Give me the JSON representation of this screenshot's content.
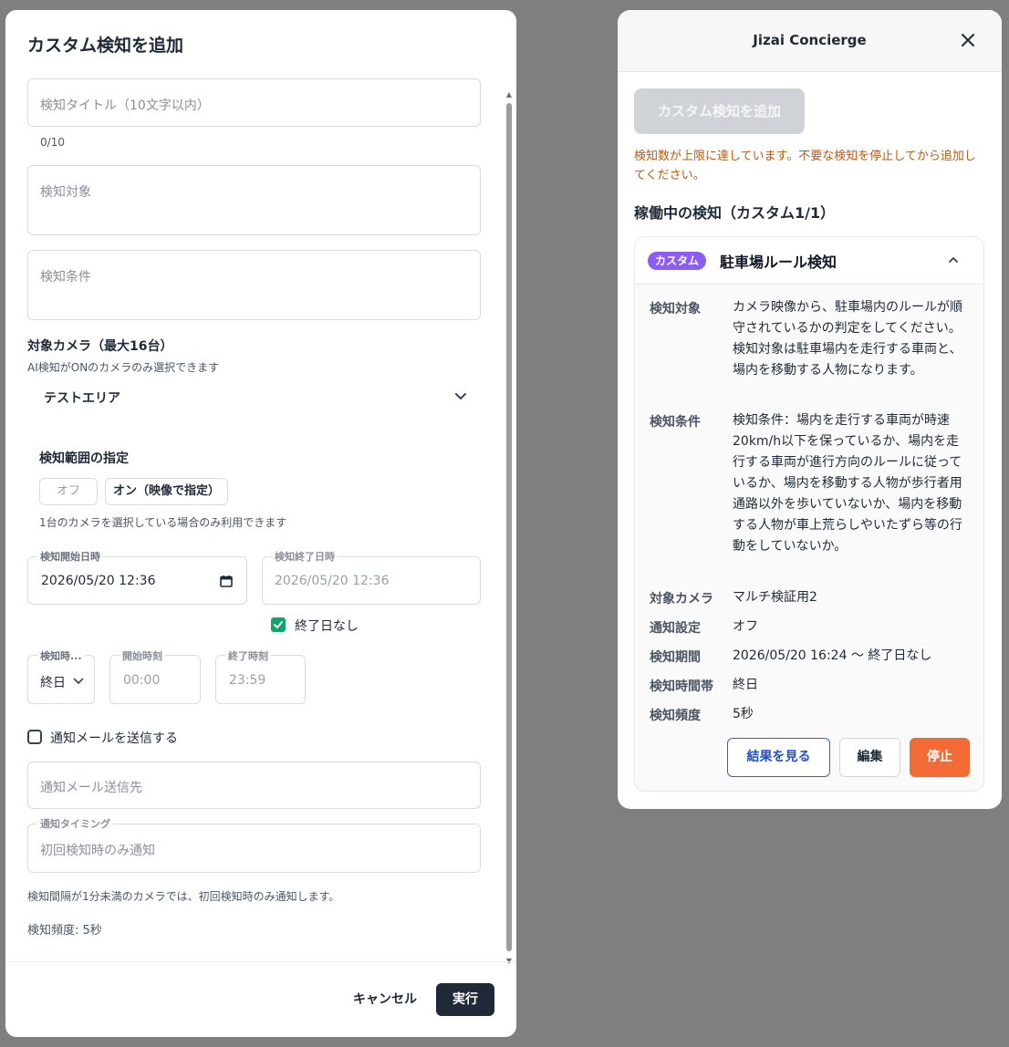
{
  "dialog": {
    "title": "カスタム検知を追加",
    "title_field": {
      "placeholder": "検知タイトル（10文字以内）",
      "counter": "0/10"
    },
    "target_field": {
      "placeholder": "検知対象"
    },
    "condition_field": {
      "placeholder": "検知条件"
    },
    "camera": {
      "title": "対象カメラ（最大16台）",
      "hint": "AI検知がONのカメラのみ選択できます",
      "selected": "テストエリア"
    },
    "range": {
      "title": "検知範囲の指定",
      "off_label": "オフ",
      "on_label": "オン（映像で指定）",
      "hint": "1台のカメラを選択している場合のみ利用できます"
    },
    "start_datetime": {
      "label": "検知開始日時",
      "value": "2026/05/20 12:36"
    },
    "end_datetime": {
      "label": "検知終了日時",
      "value": "2026/05/20 12:36"
    },
    "no_end_date": {
      "label": "終了日なし",
      "checked": true
    },
    "time_period": {
      "label": "検知時...",
      "value": "終日"
    },
    "start_time": {
      "label": "開始時刻",
      "value": "00:00"
    },
    "end_time": {
      "label": "終了時刻",
      "value": "23:59"
    },
    "send_mail": {
      "label": "通知メールを送信する",
      "checked": false
    },
    "mail_to": {
      "placeholder": "通知メール送信先"
    },
    "timing": {
      "label": "通知タイミング",
      "value": "初回検知時のみ通知"
    },
    "timing_note": "検知間隔が1分未満のカメラでは、初回検知時のみ通知します。",
    "frequency": "検知頻度: 5秒",
    "cancel_label": "キャンセル",
    "run_label": "実行"
  },
  "panel": {
    "title": "Jizai Concierge",
    "add_button": "カスタム検知を追加",
    "warning": "検知数が上限に達しています。不要な検知を停止してから追加してください。",
    "running_title": "稼働中の検知（カスタム1/1）",
    "card": {
      "badge": "カスタム",
      "title": "駐車場ルール検知",
      "rows": [
        {
          "label": "検知対象",
          "value": "カメラ映像から、駐車場内のルールが順守されているかの判定をしてください。 検知対象は駐車場内を走行する車両と、場内を移動する人物になります。"
        },
        {
          "label": "検知条件",
          "value": "検知条件：場内を走行する車両が時速20km/h以下を保っているか、場内を走行する車両が進行方向のルールに従っているか、場内を移動する人物が歩行者用通路以外を歩いていないか、場内を移動する人物が車上荒らしやいたずら等の行動をしていないか。"
        },
        {
          "label": "対象カメラ",
          "value": "マルチ検証用2"
        },
        {
          "label": "通知設定",
          "value": "オフ"
        },
        {
          "label": "検知期間",
          "value": "2026/05/20 16:24 〜 終了日なし"
        },
        {
          "label": "検知時間帯",
          "value": "終日"
        },
        {
          "label": "検知頻度",
          "value": "5秒"
        }
      ],
      "results_button": "結果を見る",
      "edit_button": "編集",
      "stop_button": "停止"
    }
  },
  "colors": {
    "accent_green": "#10a56b",
    "stop_orange": "#f26a36",
    "badge_purple": "#8b5cf6",
    "warning_orange": "#c2570c",
    "primary_dark": "#1f2937"
  }
}
